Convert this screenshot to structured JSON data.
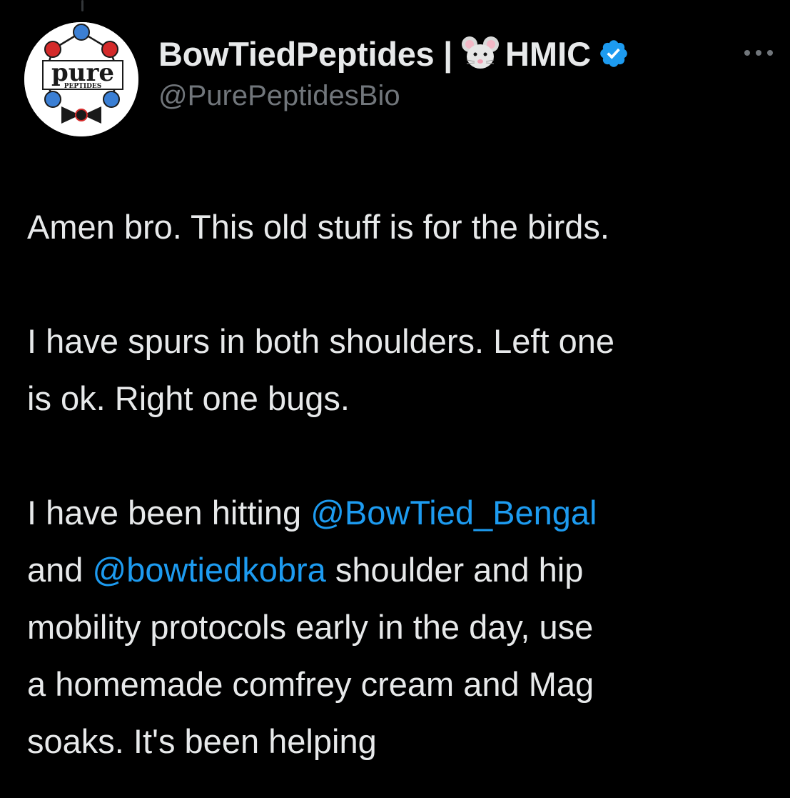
{
  "author": {
    "display_name": "BowTiedPeptides |",
    "title_suffix": "HMIC",
    "handle": "@PurePeptidesBio",
    "emoji_icon": "mouse-face-icon",
    "verified_icon": "verified-badge-icon",
    "avatar": {
      "brand_word": "pure",
      "brand_sub": "PEPTIDES"
    }
  },
  "tweet": {
    "paragraphs": {
      "p1": "Amen bro. This old stuff is for the birds.",
      "p2_line1": "I have spurs in both shoulders. Left one",
      "p2_line2": "is ok. Right one bugs.",
      "p3_part1": "I have been hitting ",
      "p3_mention1": "@BowTied_Bengal",
      "p3_part2": "and ",
      "p3_mention2": "@bowtiedkobra",
      "p3_part3": " shoulder and hip",
      "p3_line3": "mobility protocols early in the day, use",
      "p3_line4": "a homemade comfrey cream and Mag",
      "p3_line5": "soaks. It's been helping"
    }
  },
  "colors": {
    "background": "#000000",
    "text": "#e7e9ea",
    "secondary_text": "#71767b",
    "link": "#1d9bf0"
  }
}
